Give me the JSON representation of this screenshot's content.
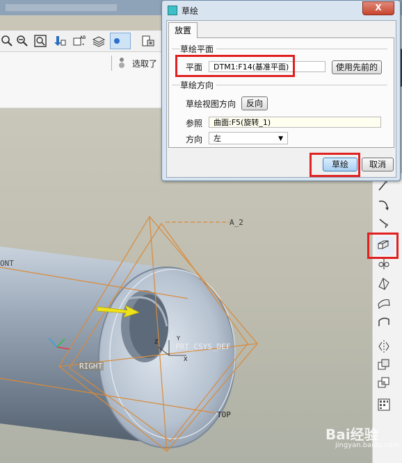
{
  "dialog": {
    "title": "草绘",
    "close": "X",
    "tab": "放置",
    "plane_group": "草绘平面",
    "plane_label": "平面",
    "plane_value": "DTM1:F14(基准平面)",
    "use_previous_button": "使用先前的",
    "direction_group": "草绘方向",
    "view_direction_label": "草绘视图方向",
    "flip_button": "反向",
    "reference_label": "参照",
    "reference_value": "曲面:F5(旋转_1)",
    "orientation_label": "方向",
    "orientation_value": "左",
    "sketch_button": "草绘",
    "cancel_button": "取消"
  },
  "toolbar": {
    "select_label": "选取了"
  },
  "viewport": {
    "datum_labels": {
      "a2": "A_2",
      "front": "ONT",
      "right": "RIGHT",
      "top": "TOP",
      "csys": "PRT_CSYS_DEF"
    },
    "axis_labels": {
      "z": "Z",
      "y": "Y",
      "x": "X"
    }
  },
  "watermark": {
    "brand": "Bai经验",
    "url": "jingyan.baidu.com"
  },
  "colors": {
    "highlight_box": "#e02020",
    "datum_plane": "#d98a3a",
    "part_body": "#8a98a8",
    "arrow": "#f0e21a"
  }
}
